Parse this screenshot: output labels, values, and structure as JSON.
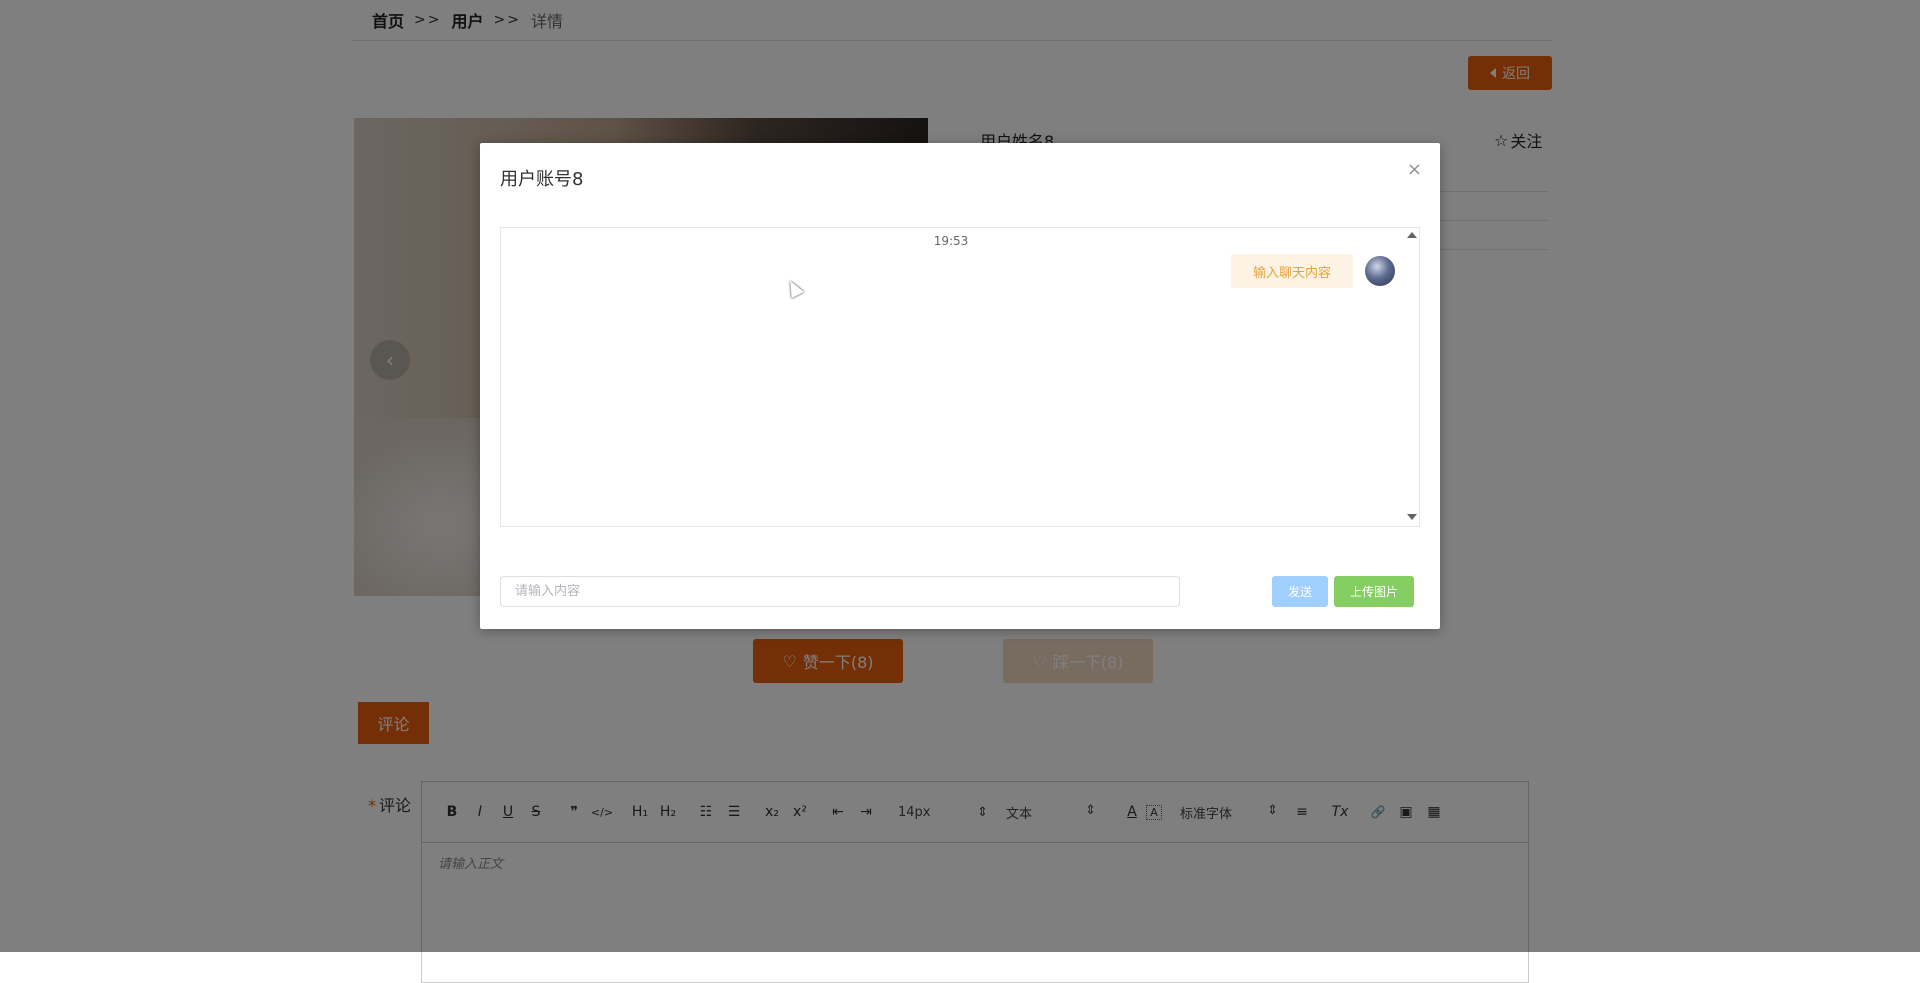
{
  "breadcrumb": {
    "home": "首页",
    "sep1": ">>",
    "section": "用户",
    "sep2": ">>",
    "current": "详情"
  },
  "header": {
    "back_label": "返回"
  },
  "profile": {
    "name": "用户姓名8",
    "follow_label": "关注",
    "follow_icon": "star-outline-icon"
  },
  "gallery": {
    "prev_arrow": "‹"
  },
  "actions": {
    "like_label": "赞一下(8)",
    "dislike_label": "踩一下(8)"
  },
  "comments": {
    "tab_label": "评论",
    "field_label": "评论",
    "required_mark": "*",
    "editor": {
      "toolbar": {
        "bold": "B",
        "italic": "I",
        "underline": "U",
        "strike": "S",
        "quote": "❞",
        "code": "</>",
        "h1": "H₁",
        "h2": "H₂",
        "ordered_list": "☷",
        "bullet_list": "☰",
        "subscript": "x₂",
        "superscript": "x²",
        "outdent": "⇤",
        "indent": "⇥",
        "font_size": "14px",
        "header_select": "文本",
        "font_family": "标准字体",
        "font_color": "A",
        "background_color": "A",
        "align": "≡",
        "clean": "Tx",
        "link": "🔗",
        "image": "▣",
        "video": "▦"
      },
      "placeholder": "请输入正文"
    }
  },
  "chat_modal": {
    "title": "用户账号8",
    "close_icon": "×",
    "timestamp": "19:53",
    "messages": [
      {
        "text": "输入聊天内容",
        "side": "right"
      }
    ],
    "input_placeholder": "请输入内容",
    "send_label": "发送",
    "upload_label": "上传图片"
  },
  "colors": {
    "accent": "#e85f0e",
    "send": "#a0cfff",
    "upload": "#85ce61",
    "bubble_bg": "#fdf3e5",
    "bubble_text": "#e6a23c"
  }
}
